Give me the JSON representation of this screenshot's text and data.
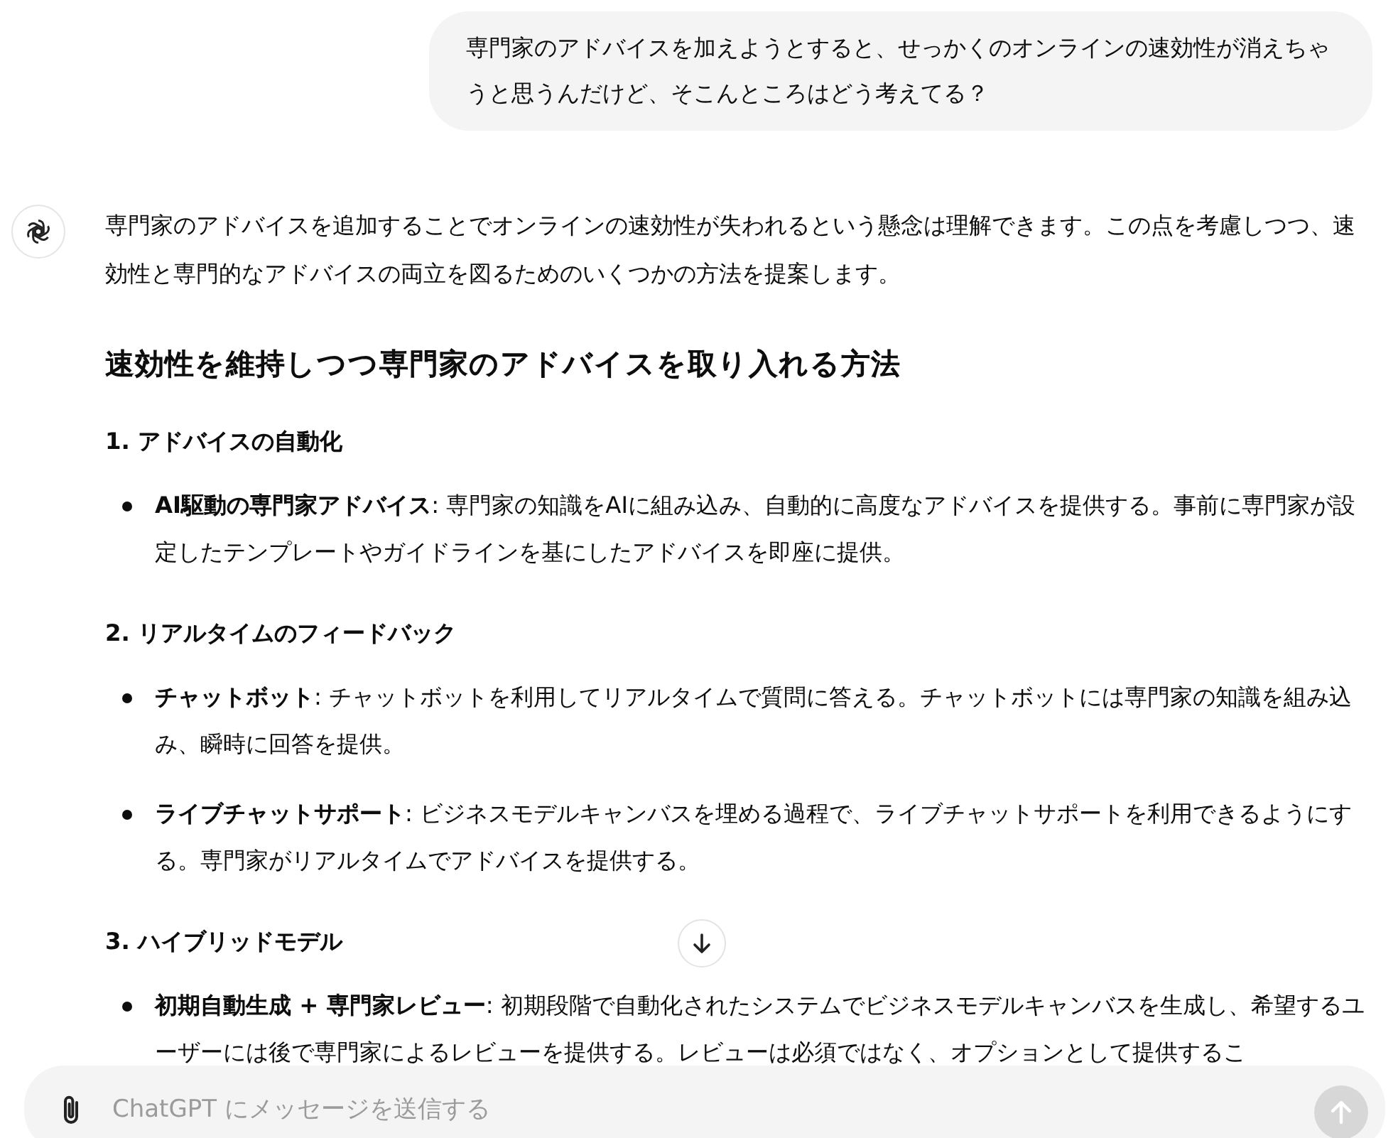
{
  "user_message": "専門家のアドバイスを加えようとすると、せっかくのオンラインの速効性が消えちゃうと思うんだけど、そこんところはどう考えてる？",
  "assistant": {
    "intro": "専門家のアドバイスを追加することでオンラインの速効性が失われるという懸念は理解できます。この点を考慮しつつ、速効性と専門的なアドバイスの両立を図るためのいくつかの方法を提案します。",
    "heading": "速効性を維持しつつ専門家のアドバイスを取り入れる方法",
    "sections": [
      {
        "title": "1. アドバイスの自動化",
        "bullets": [
          "**AI駆動の専門家アドバイス**: 専門家の知識をAIに組み込み、自動的に高度なアドバイスを提供する。事前に専門家が設定したテンプレートやガイドラインを基にしたアドバイスを即座に提供。"
        ]
      },
      {
        "title": "2. リアルタイムのフィードバック",
        "bullets": [
          "**チャットボット**: チャットボットを利用してリアルタイムで質問に答える。チャットボットには専門家の知識を組み込み、瞬時に回答を提供。",
          "**ライブチャットサポート**: ビジネスモデルキャンバスを埋める過程で、ライブチャットサポートを利用できるようにする。専門家がリアルタイムでアドバイスを提供する。"
        ]
      },
      {
        "title": "3. ハイブリッドモデル",
        "bullets": [
          "**初期自動生成 + 専門家レビュー**: 初期段階で自動化されたシステムでビジネスモデルキャンバスを生成し、希望するユーザーには後で専門家によるレビューを提供する。レビューは必須ではなく、オプションとして提供するこ"
        ]
      }
    ]
  },
  "composer": {
    "placeholder": "ChatGPT にメッセージを送信する",
    "send_disabled": true
  }
}
